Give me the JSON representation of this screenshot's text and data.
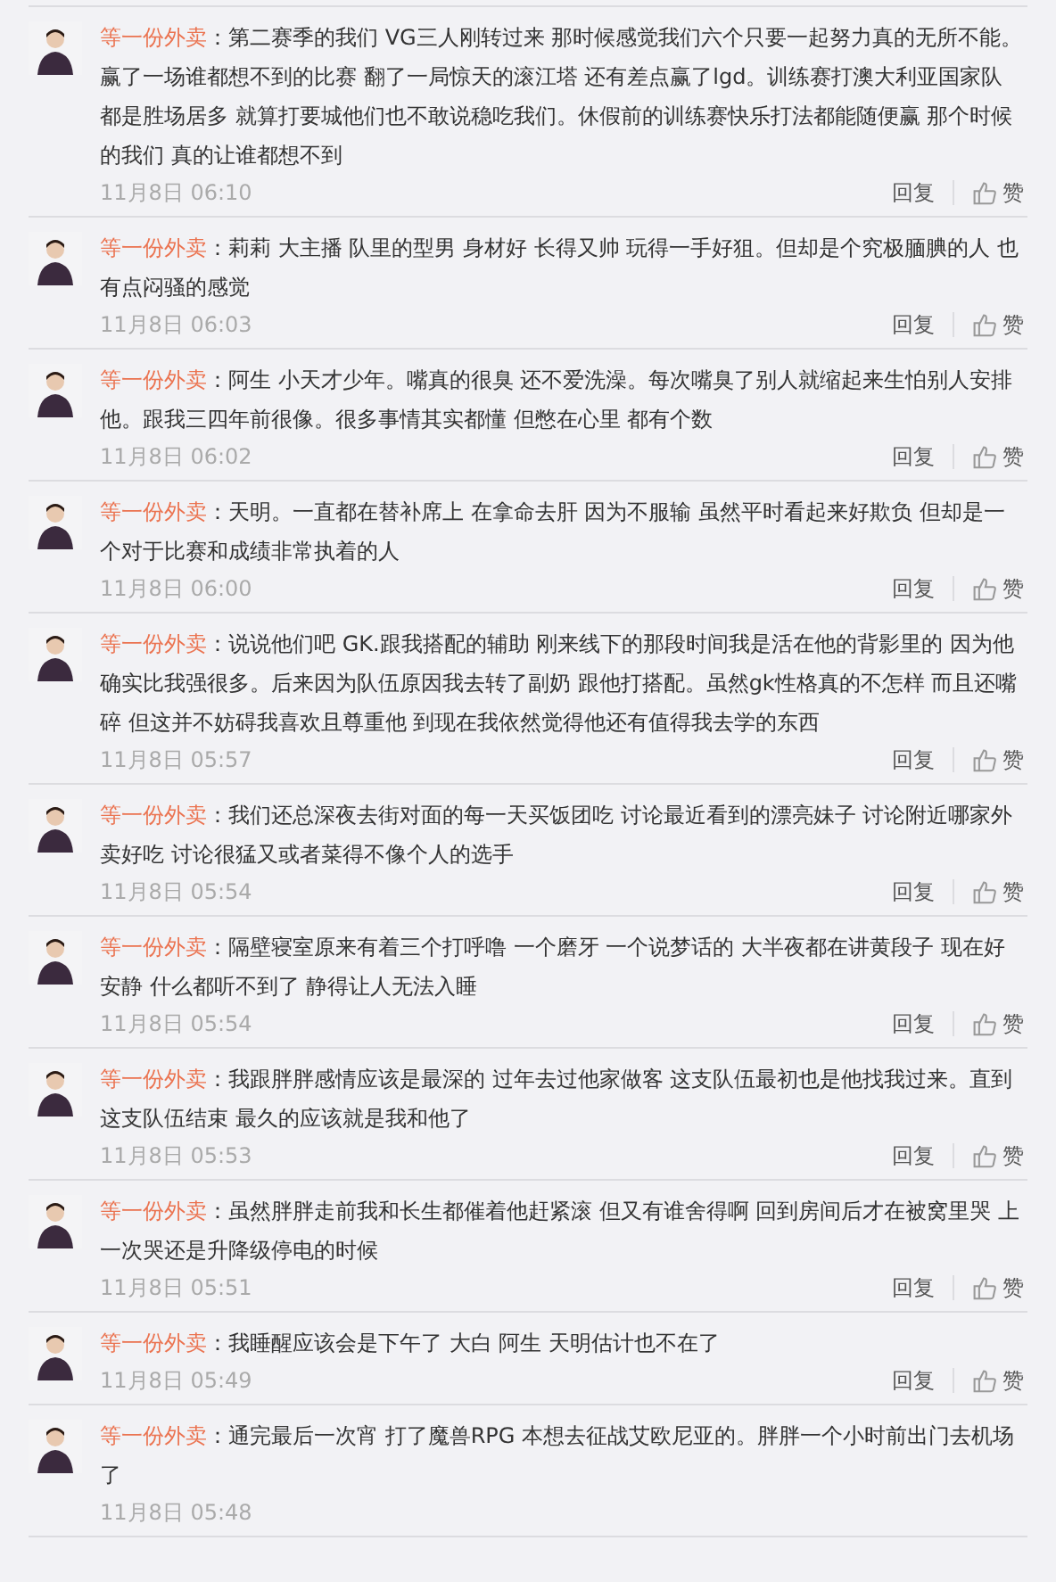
{
  "comments": [
    {
      "name": "等一份外卖",
      "text": "：第二赛季的我们 VG三人刚转过来 那时候感觉我们六个只要一起努力真的无所不能。赢了一场谁都想不到的比赛 翻了一局惊天的滚江塔 还有差点赢了lgd。训练赛打澳大利亚国家队都是胜场居多 就算打要城他们也不敢说稳吃我们。休假前的训练赛快乐打法都能随便赢 那个时候的我们 真的让谁都想不到",
      "time": "11月8日 06:10",
      "actions": {
        "reply": "回复",
        "like": "赞"
      }
    },
    {
      "name": "等一份外卖",
      "text": "：莉莉 大主播 队里的型男 身材好 长得又帅 玩得一手好狙。但却是个究极腼腆的人 也有点闷骚的感觉",
      "time": "11月8日 06:03",
      "actions": {
        "reply": "回复",
        "like": "赞"
      }
    },
    {
      "name": "等一份外卖",
      "text": "：阿生 小天才少年。嘴真的很臭 还不爱洗澡。每次嘴臭了别人就缩起来生怕别人安排他。跟我三四年前很像。很多事情其实都懂 但憋在心里 都有个数",
      "time": "11月8日 06:02",
      "actions": {
        "reply": "回复",
        "like": "赞"
      }
    },
    {
      "name": "等一份外卖",
      "text": "：天明。一直都在替补席上 在拿命去肝 因为不服输 虽然平时看起来好欺负 但却是一个对于比赛和成绩非常执着的人",
      "time": "11月8日 06:00",
      "actions": {
        "reply": "回复",
        "like": "赞"
      }
    },
    {
      "name": "等一份外卖",
      "text": "：说说他们吧 GK.跟我搭配的辅助 刚来线下的那段时间我是活在他的背影里的 因为他确实比我强很多。后来因为队伍原因我去转了副奶 跟他打搭配。虽然gk性格真的不怎样 而且还嘴碎 但这并不妨碍我喜欢且尊重他 到现在我依然觉得他还有值得我去学的东西",
      "time": "11月8日 05:57",
      "actions": {
        "reply": "回复",
        "like": "赞"
      }
    },
    {
      "name": "等一份外卖",
      "text": "：我们还总深夜去街对面的每一天买饭团吃 讨论最近看到的漂亮妹子 讨论附近哪家外卖好吃 讨论很猛又或者菜得不像个人的选手",
      "time": "11月8日 05:54",
      "actions": {
        "reply": "回复",
        "like": "赞"
      }
    },
    {
      "name": "等一份外卖",
      "text": "：隔壁寝室原来有着三个打呼噜 一个磨牙 一个说梦话的 大半夜都在讲黄段子 现在好安静 什么都听不到了 静得让人无法入睡",
      "time": "11月8日 05:54",
      "actions": {
        "reply": "回复",
        "like": "赞"
      }
    },
    {
      "name": "等一份外卖",
      "text": "：我跟胖胖感情应该是最深的 过年去过他家做客 这支队伍最初也是他找我过来。直到这支队伍结束 最久的应该就是我和他了",
      "time": "11月8日 05:53",
      "actions": {
        "reply": "回复",
        "like": "赞"
      }
    },
    {
      "name": "等一份外卖",
      "text": "：虽然胖胖走前我和长生都催着他赶紧滚 但又有谁舍得啊 回到房间后才在被窝里哭 上一次哭还是升降级停电的时候",
      "time": "11月8日 05:51",
      "actions": {
        "reply": "回复",
        "like": "赞"
      }
    },
    {
      "name": "等一份外卖",
      "text": "：我睡醒应该会是下午了 大白 阿生 天明估计也不在了",
      "time": "11月8日 05:49",
      "actions": {
        "reply": "回复",
        "like": "赞"
      }
    },
    {
      "name": "等一份外卖",
      "text": "：通完最后一次宵 打了魔兽RPG 本想去征战艾欧尼亚的。胖胖一个小时前出门去机场了",
      "time": "11月8日 05:48"
    }
  ]
}
